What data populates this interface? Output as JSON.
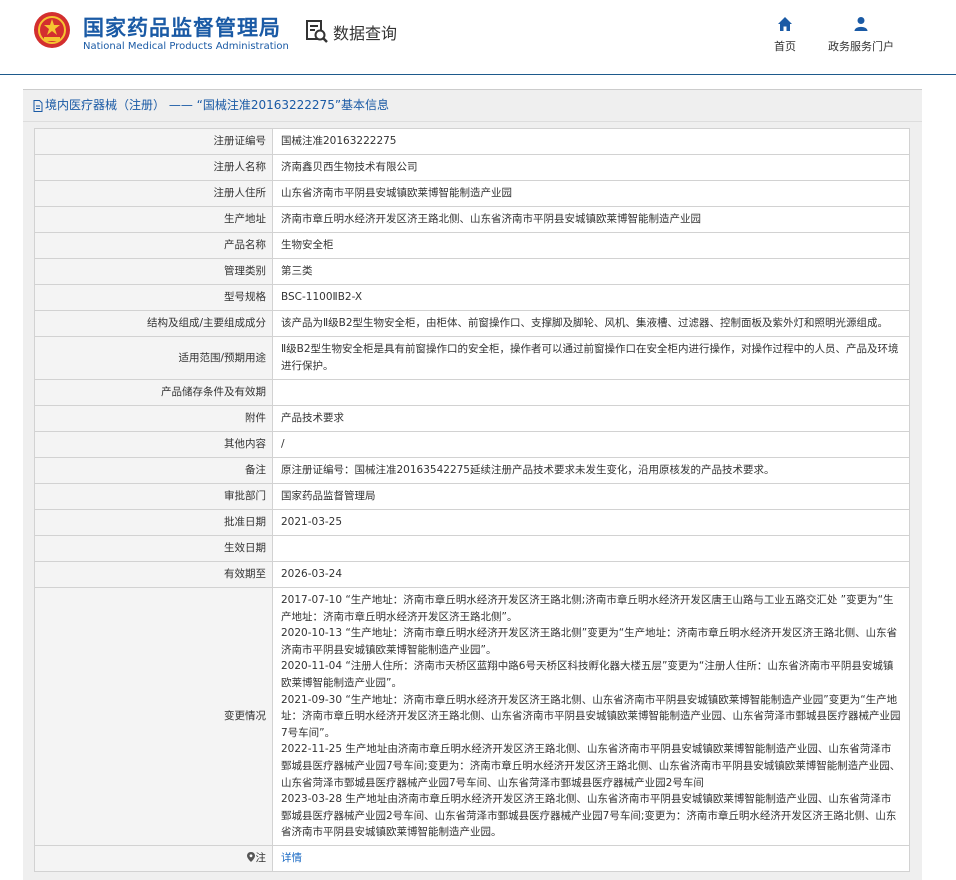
{
  "header": {
    "agency_cn": "国家药品监督管理局",
    "agency_en": "National Medical Products Administration",
    "data_query": "数据查询",
    "nav": [
      {
        "label": "首页",
        "icon": "home-icon"
      },
      {
        "label": "政务服务门户",
        "icon": "user-icon"
      }
    ]
  },
  "panel": {
    "title": "境内医疗器械（注册） —— “国械注准20163222275”基本信息"
  },
  "rows": [
    {
      "key": "注册证编号",
      "value": "国械注准20163222275"
    },
    {
      "key": "注册人名称",
      "value": "济南鑫贝西生物技术有限公司"
    },
    {
      "key": "注册人住所",
      "value": "山东省济南市平阴县安城镇欧莱博智能制造产业园"
    },
    {
      "key": "生产地址",
      "value": "济南市章丘明水经济开发区济王路北侧、山东省济南市平阴县安城镇欧莱博智能制造产业园"
    },
    {
      "key": "产品名称",
      "value": "生物安全柜"
    },
    {
      "key": "管理类别",
      "value": "第三类"
    },
    {
      "key": "型号规格",
      "value": "BSC-1100ⅡB2-X"
    },
    {
      "key": "结构及组成/主要组成成分",
      "value": "该产品为Ⅱ级B2型生物安全柜，由柜体、前窗操作口、支撑脚及脚轮、风机、集液槽、过滤器、控制面板及紫外灯和照明光源组成。"
    },
    {
      "key": "适用范围/预期用途",
      "value": "Ⅱ级B2型生物安全柜是具有前窗操作口的安全柜，操作者可以通过前窗操作口在安全柜内进行操作，对操作过程中的人员、产品及环境进行保护。"
    },
    {
      "key": "产品储存条件及有效期",
      "value": ""
    },
    {
      "key": "附件",
      "value": "产品技术要求"
    },
    {
      "key": "其他内容",
      "value": "/"
    },
    {
      "key": "备注",
      "value": "原注册证编号：国械注准20163542275延续注册产品技术要求未发生变化，沿用原核发的产品技术要求。"
    },
    {
      "key": "审批部门",
      "value": "国家药品监督管理局"
    },
    {
      "key": "批准日期",
      "value": "2021-03-25"
    },
    {
      "key": "生效日期",
      "value": ""
    },
    {
      "key": "有效期至",
      "value": "2026-03-24"
    }
  ],
  "changes": {
    "key": "变更情况",
    "entries": [
      "2017-07-10 “生产地址：济南市章丘明水经济开发区济王路北侧;济南市章丘明水经济开发区唐王山路与工业五路交汇处 ”变更为“生产地址：济南市章丘明水经济开发区济王路北侧”。",
      "2020-10-13 “生产地址：济南市章丘明水经济开发区济王路北侧”变更为“生产地址：济南市章丘明水经济开发区济王路北侧、山东省济南市平阴县安城镇欧莱博智能制造产业园”。",
      "2020-11-04 “注册人住所：济南市天桥区蓝翔中路6号天桥区科技孵化器大楼五层”变更为“注册人住所：山东省济南市平阴县安城镇欧莱博智能制造产业园”。",
      "2021-09-30 “生产地址：济南市章丘明水经济开发区济王路北侧、山东省济南市平阴县安城镇欧莱博智能制造产业园”变更为“生产地址：济南市章丘明水经济开发区济王路北侧、山东省济南市平阴县安城镇欧莱博智能制造产业园、山东省菏泽市鄄城县医疗器械产业园7号车间”。",
      "2022-11-25 生产地址由济南市章丘明水经济开发区济王路北侧、山东省济南市平阴县安城镇欧莱博智能制造产业园、山东省菏泽市鄄城县医疗器械产业园7号车间;变更为：济南市章丘明水经济开发区济王路北侧、山东省济南市平阴县安城镇欧莱博智能制造产业园、山东省菏泽市鄄城县医疗器械产业园7号车间、山东省菏泽市鄄城县医疗器械产业园2号车间",
      "2023-03-28 生产地址由济南市章丘明水经济开发区济王路北侧、山东省济南市平阴县安城镇欧莱博智能制造产业园、山东省菏泽市鄄城县医疗器械产业园2号车间、山东省菏泽市鄄城县医疗器械产业园7号车间;变更为：济南市章丘明水经济开发区济王路北侧、山东省济南市平阴县安城镇欧莱博智能制造产业园。"
    ]
  },
  "note": {
    "key": "注",
    "link": "详情"
  },
  "colors": {
    "brand": "#1a5aa5",
    "link": "#1a6ac4",
    "key_bg": "#f4f4f4",
    "border": "#d2d2d2"
  }
}
